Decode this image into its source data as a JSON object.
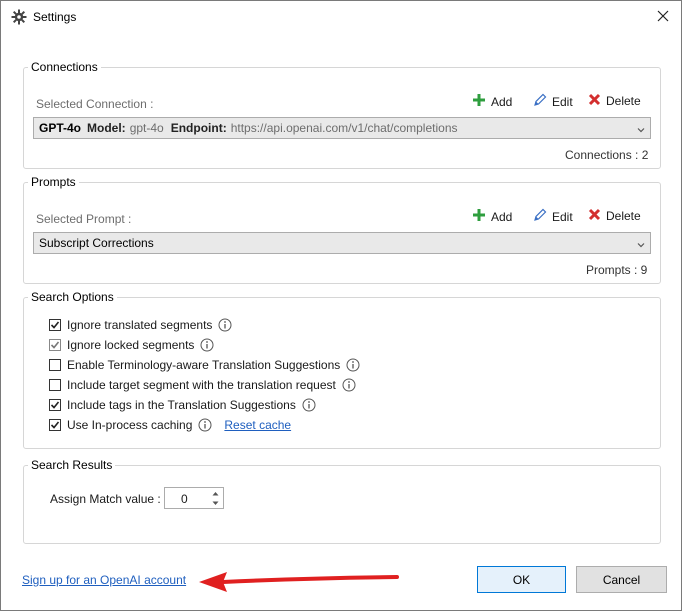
{
  "window": {
    "title": "Settings"
  },
  "connections": {
    "legend": "Connections",
    "selected_label": "Selected Connection :",
    "add_label": "Add",
    "edit_label": "Edit",
    "delete_label": "Delete",
    "selected": {
      "name": "GPT-4o",
      "model_label": "Model:",
      "model_value": "gpt-4o",
      "endpoint_label": "Endpoint:",
      "endpoint_value": "https://api.openai.com/v1/chat/completions"
    },
    "count_text": "Connections : 2"
  },
  "prompts": {
    "legend": "Prompts",
    "selected_label": "Selected Prompt :",
    "add_label": "Add",
    "edit_label": "Edit",
    "delete_label": "Delete",
    "selected": "Subscript Corrections",
    "count_text": "Prompts : 9"
  },
  "search_options": {
    "legend": "Search Options",
    "options": [
      {
        "label": "Ignore translated segments",
        "checked": true,
        "enabled": true
      },
      {
        "label": "Ignore locked segments",
        "checked": true,
        "enabled": false
      },
      {
        "label": "Enable Terminology-aware Translation Suggestions",
        "checked": false,
        "enabled": true
      },
      {
        "label": "Include target segment with the translation request",
        "checked": false,
        "enabled": true
      },
      {
        "label": "Include tags in the Translation Suggestions",
        "checked": true,
        "enabled": true
      },
      {
        "label": "Use In-process caching",
        "checked": true,
        "enabled": true
      }
    ],
    "reset_cache_label": "Reset cache"
  },
  "search_results": {
    "legend": "Search Results",
    "assign_match_label": "Assign Match value :",
    "assign_match_value": "0"
  },
  "footer": {
    "signup_link": "Sign up for an OpenAI account",
    "ok_label": "OK",
    "cancel_label": "Cancel"
  },
  "colors": {
    "link": "#1f5fbf",
    "add_icon": "#2e9e3e",
    "delete_icon": "#d32f2f",
    "edit_icon": "#3a6fc4",
    "annotation_arrow": "#e02020",
    "primary_button_border": "#0078d7"
  },
  "icons": {
    "title": "gear-icon",
    "close": "close-icon",
    "add": "plus-icon",
    "edit": "pencil-icon",
    "delete": "x-icon",
    "info": "info-icon",
    "dropdown": "chevron-down-icon",
    "annotation": "red-arrow"
  }
}
